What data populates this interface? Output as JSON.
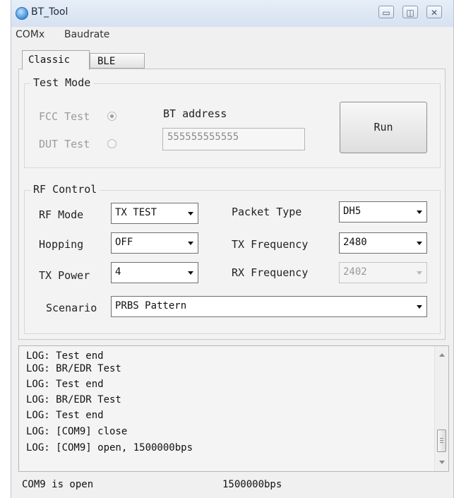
{
  "window": {
    "title": "BT_Tool"
  },
  "menu": {
    "items": [
      "COMx",
      "Baudrate"
    ]
  },
  "tabs": [
    "Classic",
    "BLE"
  ],
  "test_mode": {
    "legend": "Test Mode",
    "fcc_label": "FCC Test",
    "dut_label": "DUT Test",
    "bt_address_label": "BT address",
    "bt_address_value": "555555555555",
    "run_button": "Run"
  },
  "rf_control": {
    "legend": "RF Control",
    "rf_mode": {
      "label": "RF Mode",
      "value": "TX TEST"
    },
    "hopping": {
      "label": "Hopping",
      "value": "OFF"
    },
    "tx_power": {
      "label": "TX Power",
      "value": "4"
    },
    "packet_type": {
      "label": "Packet Type",
      "value": "DH5"
    },
    "tx_frequency": {
      "label": "TX Frequency",
      "value": "2480"
    },
    "rx_frequency": {
      "label": "RX Frequency",
      "value": "2402"
    },
    "scenario": {
      "label": "Scenario",
      "value": "PRBS Pattern"
    }
  },
  "log": [
    "LOG: Test end",
    "LOG: BR/EDR Test",
    "LOG: Test end",
    "LOG: BR/EDR Test",
    "LOG: Test end",
    "LOG: [COM9] close",
    "LOG: [COM9] open, 1500000bps"
  ],
  "status": {
    "port": "COM9 is open",
    "baudrate": "1500000bps"
  }
}
